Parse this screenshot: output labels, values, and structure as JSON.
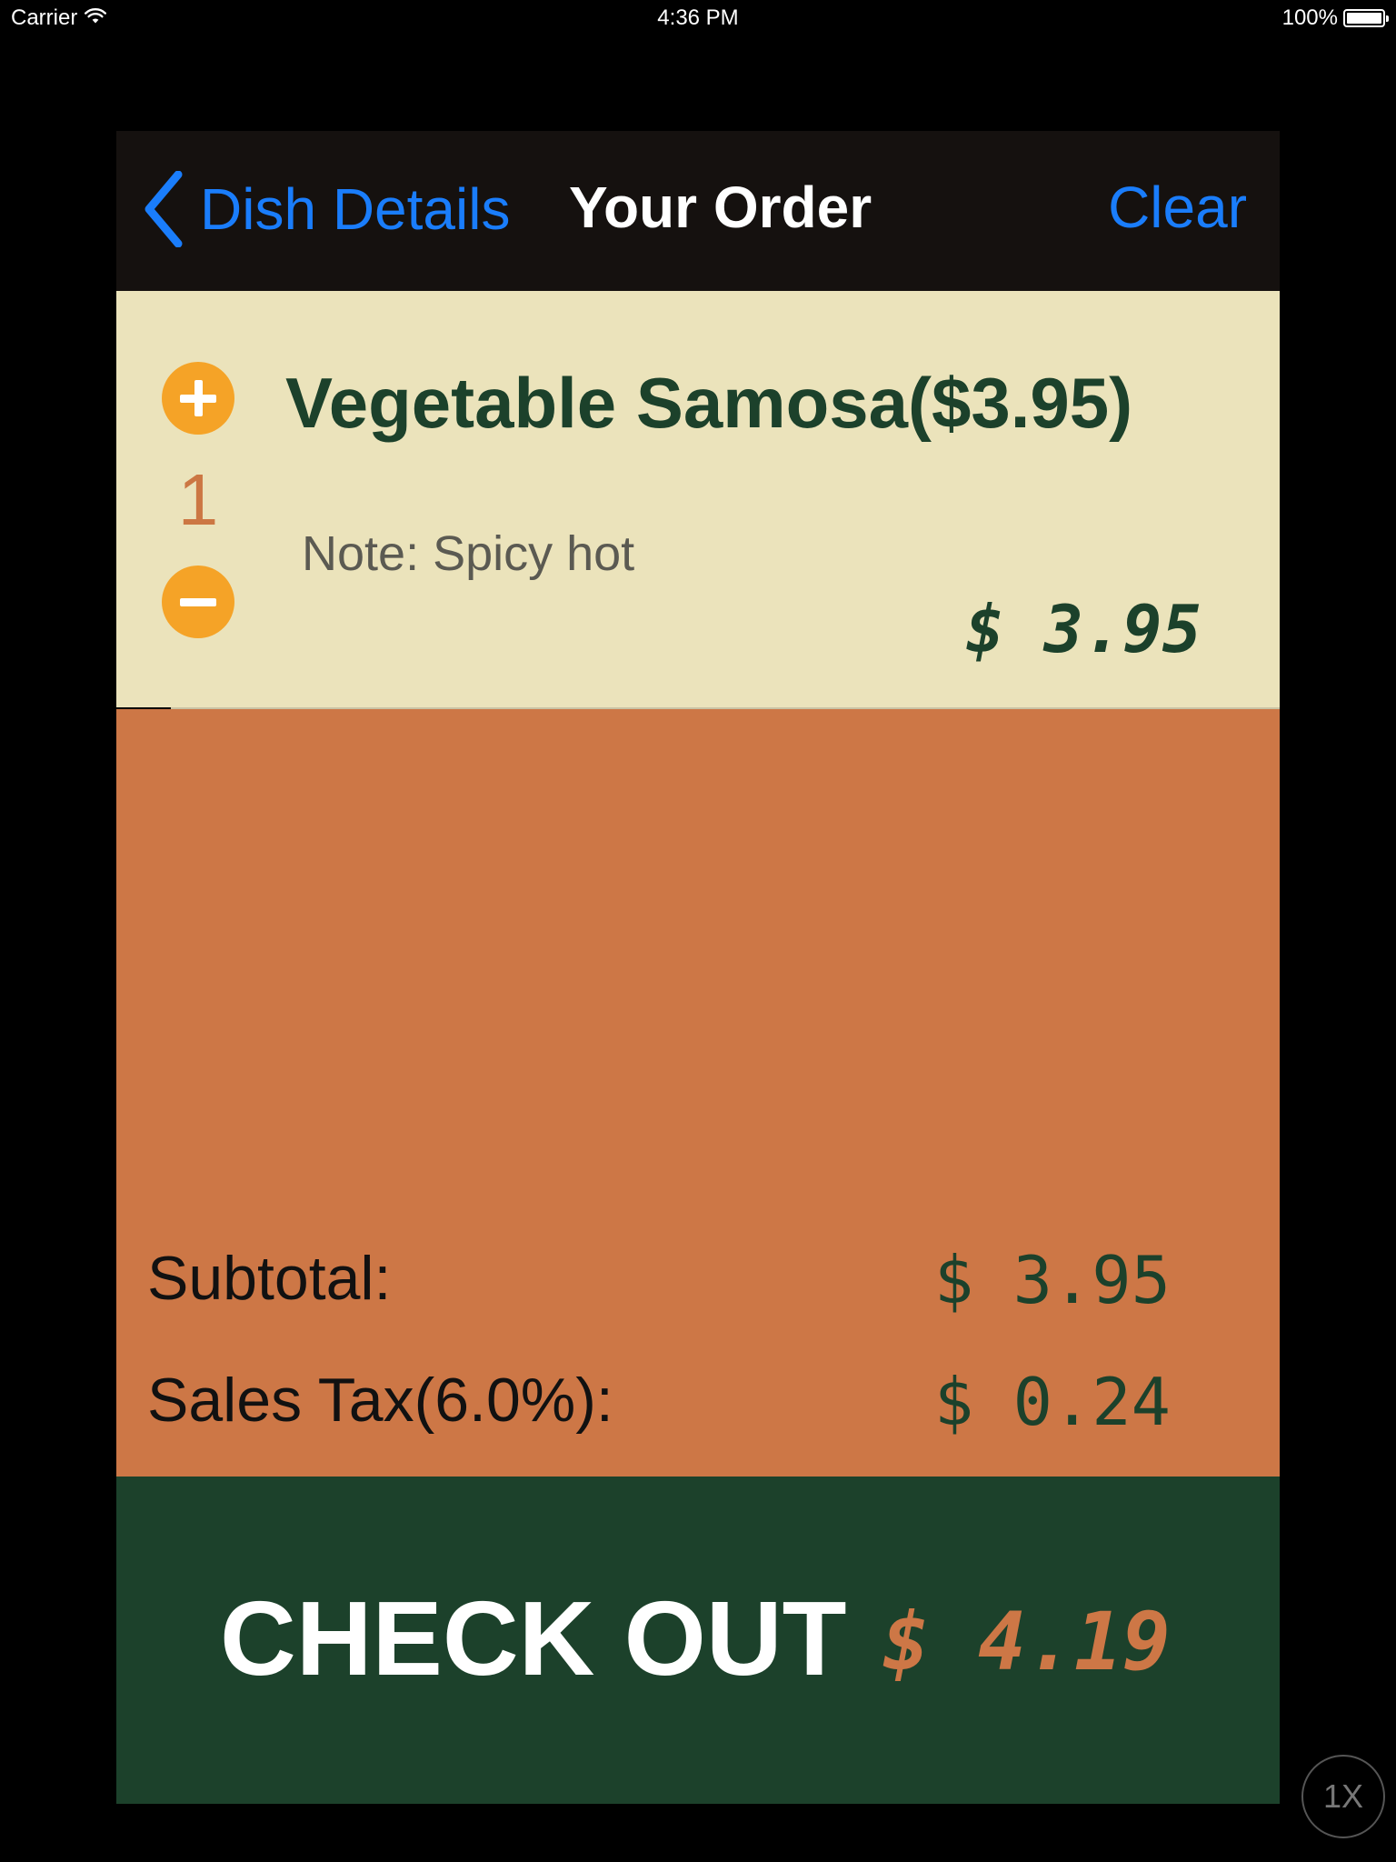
{
  "status_bar": {
    "carrier": "Carrier",
    "time": "4:36 PM",
    "battery_percent": "100%",
    "battery_level": 1.0
  },
  "navbar": {
    "back_label": "Dish Details",
    "title": "Your Order",
    "clear_label": "Clear"
  },
  "order": {
    "items": [
      {
        "name": "Vegetable Samosa($3.95)",
        "quantity": "1",
        "note": "Note: Spicy hot",
        "price": "$ 3.95"
      }
    ]
  },
  "summary": {
    "subtotal_label": "Subtotal:",
    "subtotal_value": "$ 3.95",
    "tax_label": "Sales Tax(6.0%):",
    "tax_value": "$ 0.24"
  },
  "checkout": {
    "label": "CHECK OUT",
    "total": "$ 4.19"
  },
  "zoom_button": "1X",
  "colors": {
    "navbar_bg": "#15110f",
    "link_blue": "#1a7dfb",
    "item_bg": "#ebe3bb",
    "accent_orange": "#cd7746",
    "stepper_orange": "#f5a327",
    "dark_green": "#1c412b"
  },
  "icons": {
    "back": "chevron-left-icon",
    "increment": "plus-circle-icon",
    "decrement": "minus-circle-icon",
    "wifi": "wifi-icon",
    "battery": "battery-icon"
  }
}
